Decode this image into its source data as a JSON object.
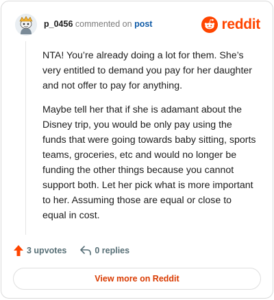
{
  "comment": {
    "username": "p_0456",
    "action_text": "commented on",
    "target_link": "post",
    "paragraphs": [
      "NTA! You’re already doing a lot for them. She’s very entitled to demand you pay for her daughter and not offer to pay for anything.",
      "Maybe tell her that if she is adamant about the Disney trip, you would be only pay using the funds that were going towards baby sitting, sports teams, groceries, etc and would no longer be funding the other things because you cannot support both. Let her pick what is more important to her. Assuming those are equal or close to equal in cost."
    ]
  },
  "brand": {
    "name": "reddit",
    "icon": "reddit-logo-icon",
    "color": "#ff4500"
  },
  "actions": {
    "upvotes_label": "3 upvotes",
    "replies_label": "0 replies",
    "upvote_icon": "upvote-arrow-icon",
    "reply_icon": "reply-arrow-icon",
    "upvote_color": "#ff4500"
  },
  "cta": {
    "label": "View more on Reddit"
  }
}
